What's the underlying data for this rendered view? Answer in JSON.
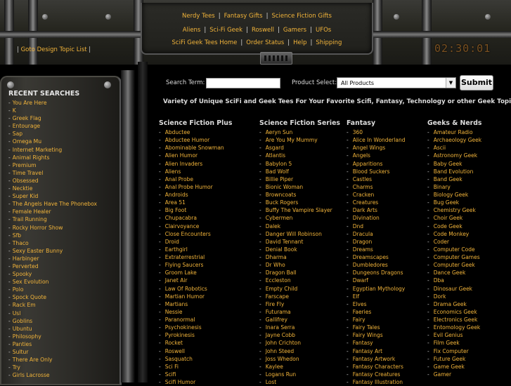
{
  "top_nav": {
    "row1": [
      "Nerdy Tees",
      "Fantasy Gifts",
      "Science Fiction Gifts"
    ],
    "row2": [
      "Aliens",
      "Sci-Fi Geek",
      "Roswell",
      "Gamers",
      "UFOs"
    ],
    "row3": [
      "SciFi Geek Tees Home",
      "Order Status",
      "Help",
      "Shipping"
    ]
  },
  "clock": "02:30:01",
  "design_link": "Goto Design Topic List",
  "sidebar": {
    "heading": "RECENT SEARCHES",
    "items": [
      "You Are Here",
      "K",
      "Greek Flag",
      "Entourage",
      "Sap",
      "Omega Mu",
      "Internet Marketing",
      "Animal Rights",
      "Premium",
      "Time Travel",
      "Obsessed",
      "Necktie",
      "Super Kid",
      "The Angels Have The Phonebox",
      "Female Healer",
      "Trail Running",
      "Rocky Horror Show",
      "Sfb",
      "Thaco",
      "Sexy Easter Bunny",
      "Harbinger",
      "Perverted",
      "Spooky",
      "Sex Evolution",
      "Polo",
      "Spock Quote",
      "Rack Em",
      "Usl",
      "Goblins",
      "Ubuntu",
      "Philosophy",
      "Panties",
      "Sultur",
      "There Are Only",
      "Try",
      "Girls Lacrosse"
    ]
  },
  "search": {
    "term_label": "Search Term:",
    "term_value": "",
    "product_label": "Product Select:",
    "product_value": "All Products",
    "submit_label": "Submit"
  },
  "tagline": "Variety of Unique SciFi and Geek Tees For Your Favorite Scifi, Fantasy, Technology or other Geek Topics.",
  "columns": [
    {
      "heading": "Science Fiction Plus",
      "items": [
        "Abductee",
        "Abductee Humor",
        "Abominable Snowman",
        "Alien Humor",
        "Alien Invaders",
        "Aliens",
        "Anal Probe",
        "Anal Probe Humor",
        "Androids",
        "Area 51",
        "Big Foot",
        "Chupacabra",
        "Clairvoyance",
        "Close Encounters",
        "Droid",
        "Earthgirl",
        "Extraterrestrial",
        "Flying Saucers",
        "Groom Lake",
        "Janet Air",
        "Law Of Robotics",
        "Martian Humor",
        "Martians",
        "Nessie",
        "Paranormal",
        "Psychokinesis",
        "Pyrokinesis",
        "Rocket",
        "Roswell",
        "Sasquatch",
        "Sci Fi",
        "Scifi",
        "Scifi Humor"
      ]
    },
    {
      "heading": "Science Fiction Series",
      "items": [
        "Aeryn Sun",
        "Are You My Mummy",
        "Asgard",
        "Atlantis",
        "Babylon 5",
        "Bad Wolf",
        "Billie Piper",
        "Bionic Woman",
        "Browncoats",
        "Buck Rogers",
        "Buffy The Vampire Slayer",
        "Cybermen",
        "Dalek",
        "Danger Will Robinson",
        "David Tennant",
        "Denial Book",
        "Dharma",
        "Dr Who",
        "Dragon Ball",
        "Eccleston",
        "Empty Child",
        "Farscape",
        "Fire Fly",
        "Futurama",
        "Gallifrey",
        "Inara Serra",
        "Jayne Cobb",
        "John Crichton",
        "John Steed",
        "Joss Whedon",
        "Kaylee",
        "Logans Run",
        "Lost"
      ]
    },
    {
      "heading": "Fantasy",
      "items": [
        "360",
        "Alice In Wonderland",
        "Angel Wings",
        "Angels",
        "Apparitions",
        "Blood Suckers",
        "Castles",
        "Charms",
        "Cracken",
        "Creatures",
        "Dark Arts",
        "Divination",
        "Dnd",
        "Dracula",
        "Dragon",
        "Dreams",
        "Dreamscapes",
        "Dumbledores",
        "Dungeons Dragons",
        "Dwarf",
        "Egyptian Mythology",
        "Elf",
        "Elves",
        "Faeries",
        "Fairy",
        "Fairy Tales",
        "Fairy Wings",
        "Fantasy",
        "Fantasy Art",
        "Fantasy Artwork",
        "Fantasy Characters",
        "Fantasy Creatures",
        "Fantasy Illustration"
      ]
    },
    {
      "heading": "Geeks & Nerds",
      "items": [
        "Amateur Radio",
        "Archaeology Geek",
        "Ascii",
        "Astronomy Geek",
        "Baby Geek",
        "Band Evolution",
        "Band Geek",
        "Binary",
        "Biology Geek",
        "Bug Geek",
        "Chemistry Geek",
        "Choir Geek",
        "Code Geek",
        "Code Monkey",
        "Coder",
        "Computer Code",
        "Computer Games",
        "Computer Geek",
        "Dance Geek",
        "Dba",
        "Dinosaur Geek",
        "Dork",
        "Drama Geek",
        "Economics Geek",
        "Electronics Geek",
        "Entomology Geek",
        "Evil Genius",
        "Film Geek",
        "Fix Computer",
        "Future Geek",
        "Game Geek",
        "Gamer"
      ]
    }
  ]
}
